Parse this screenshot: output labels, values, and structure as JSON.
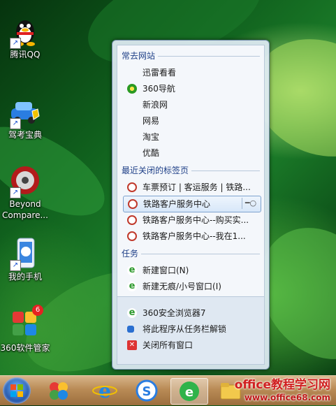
{
  "desktop": {
    "icons": [
      {
        "label": "腾讯QQ",
        "icon": "qq-penguin-icon"
      },
      {
        "label": "驾考宝典",
        "icon": "car-icon"
      },
      {
        "label": "Beyond\nCompare...",
        "icon": "beyond-compare-icon"
      },
      {
        "label": "我的手机",
        "icon": "phone-icon"
      },
      {
        "label": "360软件管家",
        "icon": "360-software-manager-icon",
        "badge": "6"
      }
    ]
  },
  "jumplist": {
    "frequent": {
      "heading": "常去网站",
      "items": [
        {
          "label": "迅雷看看",
          "icon": ""
        },
        {
          "label": "360导航",
          "icon": "360-nav-icon"
        },
        {
          "label": "新浪网",
          "icon": ""
        },
        {
          "label": "网易",
          "icon": ""
        },
        {
          "label": "淘宝",
          "icon": ""
        },
        {
          "label": "优酷",
          "icon": ""
        }
      ]
    },
    "recent": {
      "heading": "最近关闭的标签页",
      "items": [
        {
          "label": "车票预订 | 客运服务 | 铁路...",
          "icon": "railway-icon"
        },
        {
          "label": "铁路客户服务中心",
          "icon": "railway-icon",
          "selected": true
        },
        {
          "label": "铁路客户服务中心--购买实...",
          "icon": "railway-icon"
        },
        {
          "label": "铁路客户服务中心--我在1...",
          "icon": "railway-icon"
        }
      ]
    },
    "tasks": {
      "heading": "任务",
      "items": [
        {
          "label": "新建窗口(N)",
          "icon": "ie-e-icon"
        },
        {
          "label": "新建无痕/小号窗口(I)",
          "icon": "ie-e-icon"
        }
      ]
    },
    "bottom": [
      {
        "label": "360安全浏览器7",
        "icon": "360-browser-icon"
      },
      {
        "label": "将此程序从任务栏解锁",
        "icon": "unpin-icon"
      },
      {
        "label": "关闭所有窗口",
        "icon": "close-window-icon"
      }
    ]
  },
  "watermark": {
    "title": "office教程学习网",
    "url": "www.office68.com"
  },
  "colors": {
    "accent": "#1e3f87",
    "taskbar": "#b98b56",
    "selection": "#7da2ce"
  }
}
